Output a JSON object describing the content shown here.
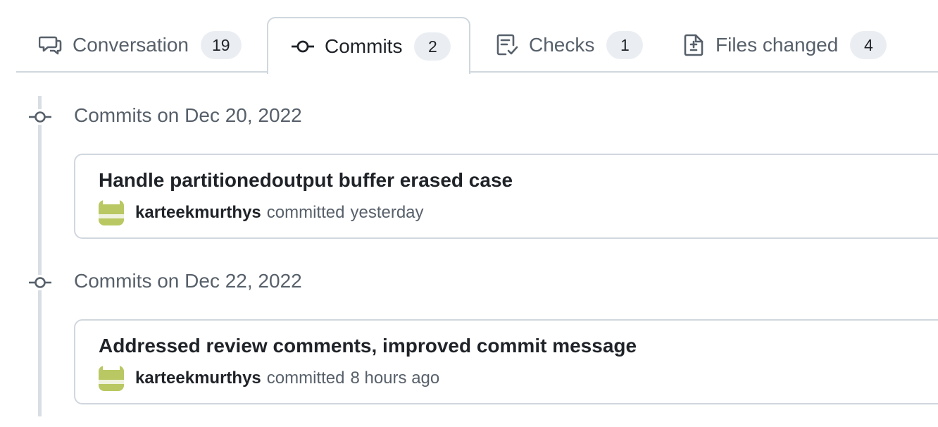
{
  "tabs": [
    {
      "label": "Conversation",
      "count": "19",
      "icon": "comment-discussion-icon"
    },
    {
      "label": "Commits",
      "count": "2",
      "icon": "git-commit-icon"
    },
    {
      "label": "Checks",
      "count": "1",
      "icon": "checklist-icon"
    },
    {
      "label": "Files changed",
      "count": "4",
      "icon": "file-diff-icon"
    }
  ],
  "selected_tab": "Commits",
  "commit_groups": [
    {
      "title": "Commits on Dec 20, 2022",
      "commits": [
        {
          "message": "Handle partitionedoutput buffer erased case",
          "author": "karteekmurthys",
          "action": "committed",
          "time": "yesterday"
        }
      ]
    },
    {
      "title": "Commits on Dec 22, 2022",
      "commits": [
        {
          "message": "Addressed review comments, improved commit message",
          "author": "karteekmurthys",
          "action": "committed",
          "time": "8 hours ago"
        }
      ]
    }
  ],
  "colors": {
    "accent_border": "#d0d7de",
    "avatar": "#b9c862",
    "muted_text": "#57606a"
  }
}
